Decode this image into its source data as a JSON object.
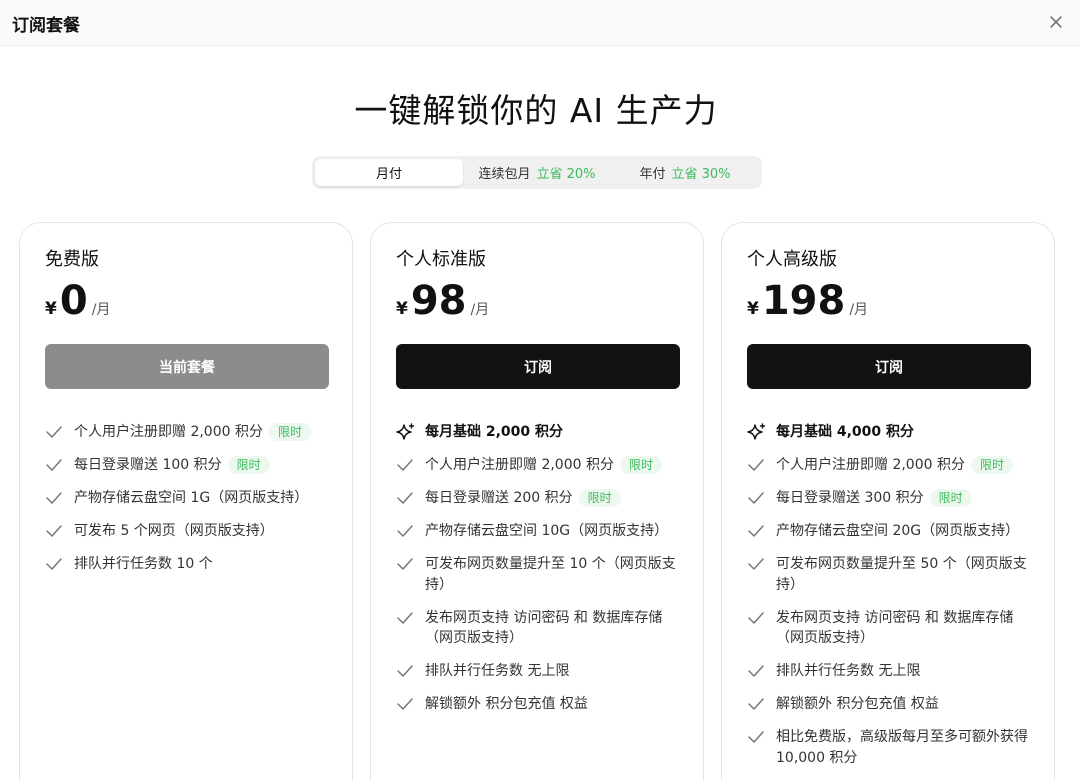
{
  "window": {
    "title": "订阅套餐",
    "close_icon": "close-icon"
  },
  "headline": "一键解锁你的 AI 生产力",
  "billing": {
    "options": [
      {
        "label": "月付",
        "save": "",
        "active": true
      },
      {
        "label": "连续包月",
        "save": "立省 20%",
        "active": false
      },
      {
        "label": "年付",
        "save": "立省 30%",
        "active": false
      }
    ]
  },
  "colors": {
    "accent_green": "#3dbb5c",
    "primary_button": "#121212",
    "current_button": "#8c8c8c"
  },
  "plans": [
    {
      "name": "免费版",
      "currency": "¥",
      "price": "0",
      "unit": "/月",
      "button": "当前套餐",
      "base": "",
      "features": [
        {
          "text": "个人用户注册即赠 2,000 积分",
          "badge": "限时"
        },
        {
          "text": "每日登录赠送 100 积分",
          "badge": "限时"
        },
        {
          "text": "产物存储云盘空间 1G（网页版支持）",
          "badge": ""
        },
        {
          "text": "可发布 5 个网页（网页版支持）",
          "badge": ""
        },
        {
          "text": "排队并行任务数 10 个",
          "badge": ""
        }
      ]
    },
    {
      "name": "个人标准版",
      "currency": "¥",
      "price": "98",
      "unit": "/月",
      "button": "订阅",
      "base": "每月基础 2,000 积分",
      "features": [
        {
          "text": "个人用户注册即赠 2,000 积分",
          "badge": "限时"
        },
        {
          "text": "每日登录赠送 200 积分",
          "badge": "限时"
        },
        {
          "text": "产物存储云盘空间 10G（网页版支持）",
          "badge": ""
        },
        {
          "text": "可发布网页数量提升至 10 个（网页版支持）",
          "badge": ""
        },
        {
          "text": "发布网页支持 访问密码 和 数据库存储（网页版支持）",
          "badge": ""
        },
        {
          "text": "排队并行任务数 无上限",
          "badge": ""
        },
        {
          "text": "解锁额外 积分包充值 权益",
          "badge": ""
        }
      ]
    },
    {
      "name": "个人高级版",
      "currency": "¥",
      "price": "198",
      "unit": "/月",
      "button": "订阅",
      "base": "每月基础 4,000 积分",
      "features": [
        {
          "text": "个人用户注册即赠 2,000 积分",
          "badge": "限时"
        },
        {
          "text": "每日登录赠送 300 积分",
          "badge": "限时"
        },
        {
          "text": "产物存储云盘空间 20G（网页版支持）",
          "badge": ""
        },
        {
          "text": "可发布网页数量提升至 50 个（网页版支持）",
          "badge": ""
        },
        {
          "text": "发布网页支持 访问密码 和 数据库存储（网页版支持）",
          "badge": ""
        },
        {
          "text": "排队并行任务数 无上限",
          "badge": ""
        },
        {
          "text": "解锁额外 积分包充值 权益",
          "badge": ""
        },
        {
          "text": "相比免费版，高级版每月至多可额外获得 10,000 积分",
          "badge": ""
        }
      ]
    }
  ]
}
